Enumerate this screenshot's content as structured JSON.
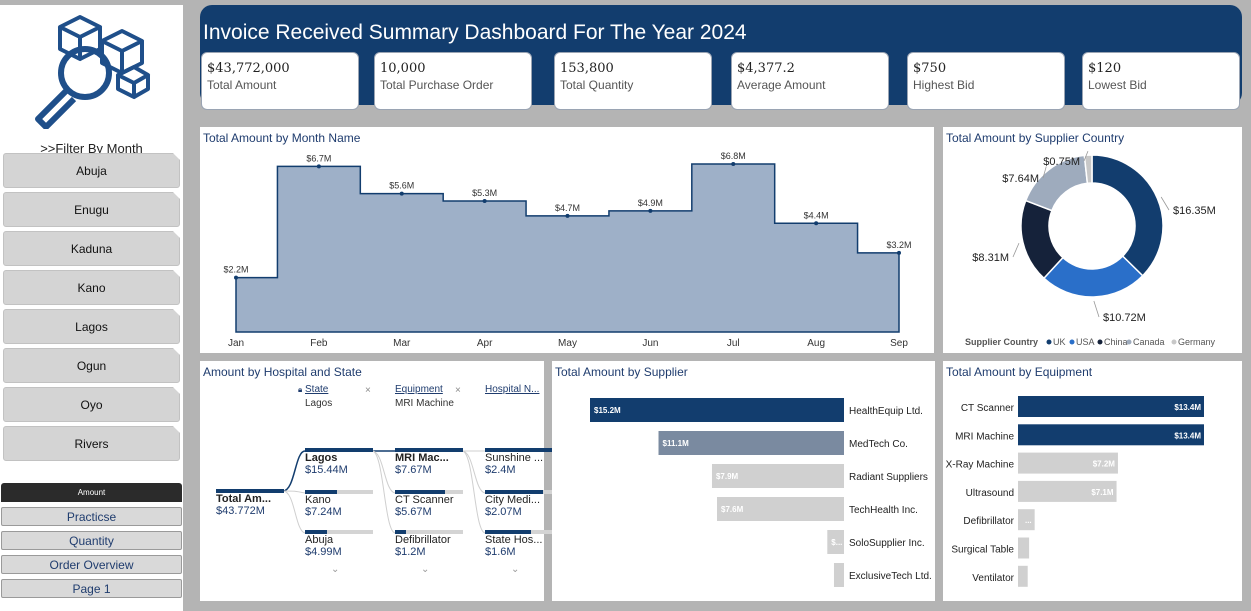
{
  "sidebar": {
    "filter_title": ">>Filter By Month",
    "months": [
      "Abuja",
      "Enugu",
      "Kaduna",
      "Kano",
      "Lagos",
      "Ogun",
      "Oyo",
      "Rivers"
    ],
    "amount_label": "Amount",
    "nav": [
      "Practicse",
      "Quantity",
      "Order Overview",
      "Page 1"
    ]
  },
  "header": {
    "title": "Invoice Received Summary Dashboard For The Year 2024",
    "kpis": [
      {
        "value": "$43,772,000",
        "label": "Total Amount"
      },
      {
        "value": "10,000",
        "label": "Total Purchase Order"
      },
      {
        "value": "153,800",
        "label": "Total Quantity"
      },
      {
        "value": "$4,377.2",
        "label": "Average Amount"
      },
      {
        "value": "$750",
        "label": "Highest Bid"
      },
      {
        "value": "$120",
        "label": "Lowest Bid"
      }
    ]
  },
  "colors": {
    "navy": "#123d6e",
    "area_fill": "#9eb0c8",
    "uk": "#123d6e",
    "usa": "#2a6fc9",
    "china": "#15223a",
    "canada": "#9eabbd",
    "germany": "#c8c8c8"
  },
  "panels": {
    "month_title": "Total Amount by Month Name",
    "country_title": "Total Amount by Supplier Country",
    "hospital_title": "Amount by Hospital and State",
    "supplier_title": "Total Amount by Supplier",
    "equipment_title": "Total Amount by Equipment"
  },
  "chart_data": [
    {
      "type": "area",
      "title": "Total Amount by Month Name",
      "categories": [
        "Jan",
        "Feb",
        "Mar",
        "Apr",
        "May",
        "Jun",
        "Jul",
        "Aug",
        "Sep"
      ],
      "values": [
        2.2,
        6.7,
        5.6,
        5.3,
        4.7,
        4.9,
        6.8,
        4.4,
        3.2
      ],
      "labels": [
        "$2.2M",
        "$6.7M",
        "$5.6M",
        "$5.3M",
        "$4.7M",
        "$4.9M",
        "$6.8M",
        "$4.4M",
        "$3.2M"
      ],
      "unit": "M"
    },
    {
      "type": "pie",
      "title": "Total Amount by Supplier Country",
      "legend_title": "Supplier Country",
      "categories": [
        "UK",
        "USA",
        "China",
        "Canada",
        "Germany"
      ],
      "values": [
        16.35,
        10.72,
        8.31,
        7.64,
        0.75
      ],
      "labels": [
        "$16.35M",
        "$10.72M",
        "$8.31M",
        "$7.64M",
        "$0.75M"
      ],
      "legend_position": "bottom"
    },
    {
      "type": "bar",
      "title": "Total Amount by Supplier",
      "categories": [
        "HealthEquip Ltd.",
        "MedTech Co.",
        "Radiant Suppliers",
        "TechHealth Inc.",
        "SoloSupplier Inc.",
        "ExclusiveTech Ltd."
      ],
      "values": [
        15.2,
        11.1,
        7.9,
        7.6,
        1.0,
        0.6
      ],
      "labels": [
        "$15.2M",
        "$11.1M",
        "$7.9M",
        "$7.6M",
        "$...",
        ""
      ]
    },
    {
      "type": "bar",
      "title": "Total Amount by Equipment",
      "categories": [
        "CT Scanner",
        "MRI Machine",
        "X-Ray Machine",
        "Ultrasound",
        "Defibrillator",
        "Surgical Table",
        "Ventilator"
      ],
      "values": [
        13.4,
        13.4,
        7.2,
        7.1,
        1.2,
        0.8,
        0.7
      ],
      "labels": [
        "$13.4M",
        "$13.4M",
        "$7.2M",
        "$7.1M",
        "...",
        "",
        ""
      ]
    }
  ],
  "decomp": {
    "headers": {
      "state": "State",
      "equipment": "Equipment",
      "hospital": "Hospital N..."
    },
    "filters": {
      "state": "Lagos",
      "equipment": "MRI Machine"
    },
    "root": {
      "name": "Total Am...",
      "value": "$43.772M"
    },
    "states": [
      {
        "name": "Lagos",
        "value": "$15.44M",
        "fill": 1.0
      },
      {
        "name": "Kano",
        "value": "$7.24M",
        "fill": 0.47
      },
      {
        "name": "Abuja",
        "value": "$4.99M",
        "fill": 0.32
      }
    ],
    "equipment": [
      {
        "name": "MRI Mac...",
        "value": "$7.67M",
        "fill": 1.0
      },
      {
        "name": "CT Scanner",
        "value": "$5.67M",
        "fill": 0.74
      },
      {
        "name": "Defibrillator",
        "value": "$1.2M",
        "fill": 0.16
      }
    ],
    "hospitals": [
      {
        "name": "Sunshine ...",
        "value": "$2.4M",
        "fill": 1.0
      },
      {
        "name": "City Medi...",
        "value": "$2.07M",
        "fill": 0.86
      },
      {
        "name": "State Hos...",
        "value": "$1.6M",
        "fill": 0.67
      }
    ]
  }
}
